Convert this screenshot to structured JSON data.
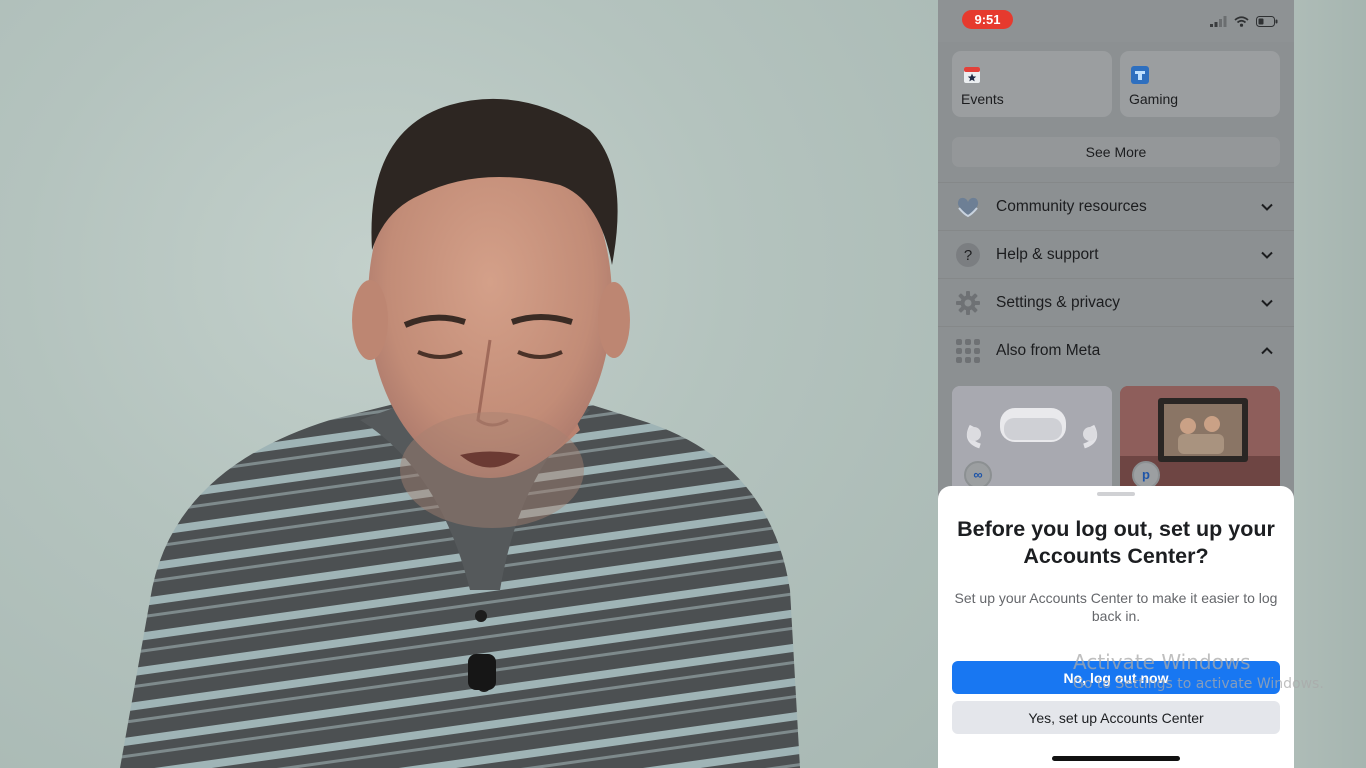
{
  "status_bar": {
    "time": "9:51"
  },
  "shortcuts": [
    {
      "label": "Events",
      "icon": "calendar-star-icon"
    },
    {
      "label": "Gaming",
      "icon": "gaming-icon"
    }
  ],
  "see_more_label": "See More",
  "menu": [
    {
      "label": "Community resources",
      "icon": "heart-hands-icon",
      "expanded": false
    },
    {
      "label": "Help & support",
      "icon": "question-icon",
      "expanded": false
    },
    {
      "label": "Settings & privacy",
      "icon": "gear-icon",
      "expanded": false
    },
    {
      "label": "Also from Meta",
      "icon": "grid-icon",
      "expanded": true
    }
  ],
  "meta_apps": [
    {
      "icon": "meta-logo-icon",
      "badge": "∞"
    },
    {
      "icon": "portal-logo-icon",
      "badge": "p"
    }
  ],
  "dialog": {
    "title": "Before you log out, set up your Accounts Center?",
    "description": "Set up your Accounts Center to make it easier to log back in.",
    "primary_button": "No, log out now",
    "secondary_button": "Yes, set up Accounts Center"
  },
  "watermark": {
    "title": "Activate Windows",
    "subtitle": "Go to Settings to activate Windows."
  },
  "colors": {
    "accent": "#1877f2",
    "time_pill": "#e63a2e",
    "sheet_bg": "#ffffff"
  }
}
